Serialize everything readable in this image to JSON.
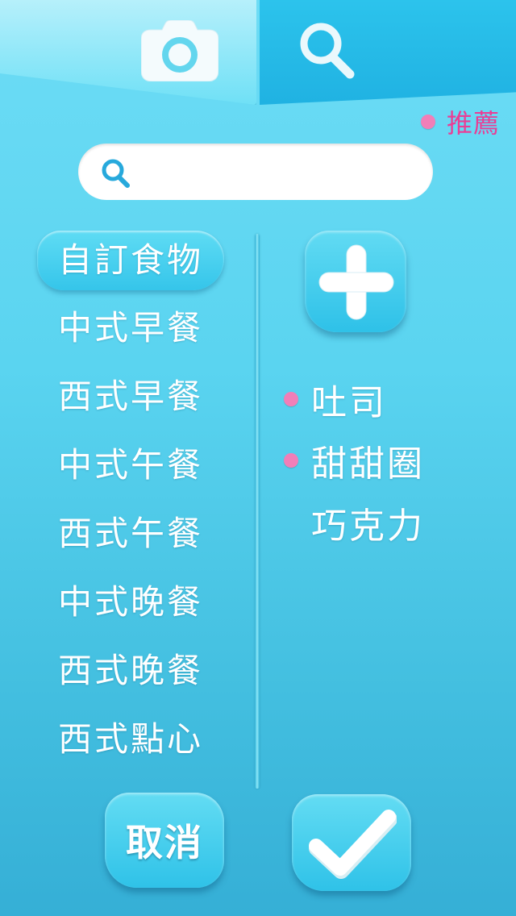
{
  "tabs": [
    {
      "icon": "camera-icon",
      "active": true
    },
    {
      "icon": "search-icon",
      "active": false
    }
  ],
  "recommend": {
    "label": "推薦",
    "dot_color": "#f17fb8",
    "label_color": "#ea3d95"
  },
  "search": {
    "placeholder": "",
    "value": ""
  },
  "categories": {
    "selected": "自訂食物",
    "items": [
      "自訂食物",
      "中式早餐",
      "西式早餐",
      "中式午餐",
      "西式午餐",
      "中式晚餐",
      "西式晚餐",
      "西式點心"
    ]
  },
  "foods": [
    {
      "label": "吐司",
      "recommended": true
    },
    {
      "label": "甜甜圈",
      "recommended": true
    },
    {
      "label": "巧克力",
      "recommended": false
    }
  ],
  "buttons": {
    "cancel_label": "取消",
    "confirm_icon": "checkmark-icon",
    "add_icon": "plus-icon"
  }
}
